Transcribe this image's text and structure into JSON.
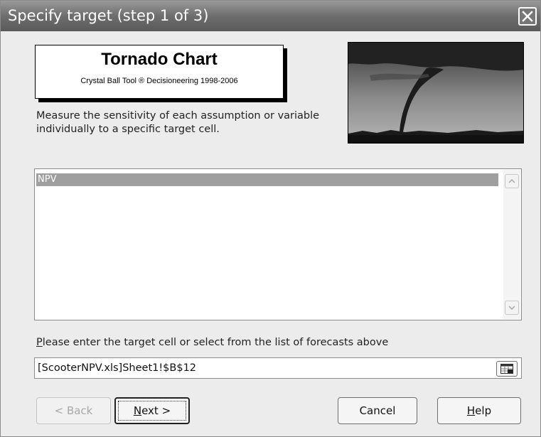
{
  "window": {
    "title": "Specify target (step 1 of 3)",
    "close_icon": "close-icon"
  },
  "header": {
    "title": "Tornado Chart",
    "subtitle": "Crystal Ball Tool ® Decisioneering 1998-2006",
    "image": "tornado-photo"
  },
  "description": "Measure the sensitivity of each assumption or variable individually to a specific target cell.",
  "forecast_list": {
    "items": [
      "NPV"
    ],
    "selected_index": 0
  },
  "target": {
    "prompt_first": "P",
    "prompt_rest": "lease enter the target cell or select from the list of forecasts above",
    "value": "[ScooterNPV.xls]Sheet1!$B$12",
    "picker_icon": "range-select-icon"
  },
  "buttons": {
    "back": "< Back",
    "next_mnemonic": "N",
    "next_rest": "ext >",
    "cancel": "Cancel",
    "help_mnemonic": "H",
    "help_rest": "elp"
  },
  "colors": {
    "titlebar": "#6e6e6e",
    "selection": "#9f9f9f",
    "dialog_bg": "#ececec"
  }
}
